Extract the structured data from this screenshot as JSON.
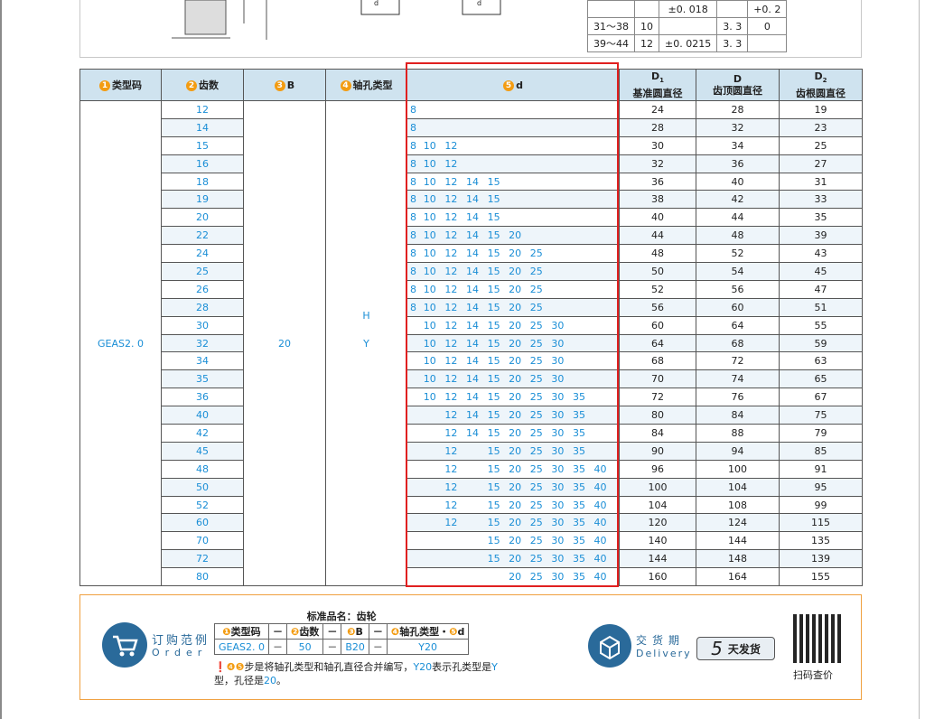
{
  "tolerance_rows": [
    {
      "range": "",
      "val": "",
      "tol": "±0. 018",
      "d": "",
      "extra": "+0. 2"
    },
    {
      "range": "31～38",
      "val": "10",
      "tol": "",
      "d": "3. 3",
      "extra": "0"
    },
    {
      "range": "39～44",
      "val": "12",
      "tol": "±0. 0215",
      "d": "3. 3",
      "extra": ""
    }
  ],
  "drawing_labels": {
    "d1": "d",
    "d2": "d"
  },
  "headers": {
    "type_code": {
      "num": "1",
      "label": "类型码"
    },
    "teeth": {
      "num": "2",
      "label": "齿数"
    },
    "b": {
      "num": "3",
      "label": "B"
    },
    "bore_type": {
      "num": "4",
      "label": "轴孔类型"
    },
    "d": {
      "num": "5",
      "label": "d"
    },
    "d1": {
      "sym": "D",
      "sub": "1",
      "label": "基准圆直径"
    },
    "D": {
      "sym": "D",
      "label": "齿顶圆直径"
    },
    "d2": {
      "sym": "D",
      "sub": "2",
      "label": "齿根圆直径"
    }
  },
  "merged": {
    "type_code": "GEAS2. 0",
    "b": "20",
    "bore_h": "H",
    "bore_y": "Y"
  },
  "rows": [
    {
      "z": "12",
      "d": [
        "8",
        "",
        "",
        "",
        "",
        "",
        "",
        "",
        "",
        ""
      ],
      "d1": "24",
      "D": "28",
      "d2": "19"
    },
    {
      "z": "14",
      "d": [
        "8",
        "",
        "",
        "",
        "",
        "",
        "",
        "",
        "",
        ""
      ],
      "d1": "28",
      "D": "32",
      "d2": "23"
    },
    {
      "z": "15",
      "d": [
        "8",
        "10",
        "12",
        "",
        "",
        "",
        "",
        "",
        "",
        ""
      ],
      "d1": "30",
      "D": "34",
      "d2": "25"
    },
    {
      "z": "16",
      "d": [
        "8",
        "10",
        "12",
        "",
        "",
        "",
        "",
        "",
        "",
        ""
      ],
      "d1": "32",
      "D": "36",
      "d2": "27"
    },
    {
      "z": "18",
      "d": [
        "8",
        "10",
        "12",
        "14",
        "15",
        "",
        "",
        "",
        "",
        ""
      ],
      "d1": "36",
      "D": "40",
      "d2": "31"
    },
    {
      "z": "19",
      "d": [
        "8",
        "10",
        "12",
        "14",
        "15",
        "",
        "",
        "",
        "",
        ""
      ],
      "d1": "38",
      "D": "42",
      "d2": "33"
    },
    {
      "z": "20",
      "d": [
        "8",
        "10",
        "12",
        "14",
        "15",
        "",
        "",
        "",
        "",
        ""
      ],
      "d1": "40",
      "D": "44",
      "d2": "35"
    },
    {
      "z": "22",
      "d": [
        "8",
        "10",
        "12",
        "14",
        "15",
        "20",
        "",
        "",
        "",
        ""
      ],
      "d1": "44",
      "D": "48",
      "d2": "39"
    },
    {
      "z": "24",
      "d": [
        "8",
        "10",
        "12",
        "14",
        "15",
        "20",
        "25",
        "",
        "",
        ""
      ],
      "d1": "48",
      "D": "52",
      "d2": "43"
    },
    {
      "z": "25",
      "d": [
        "8",
        "10",
        "12",
        "14",
        "15",
        "20",
        "25",
        "",
        "",
        ""
      ],
      "d1": "50",
      "D": "54",
      "d2": "45"
    },
    {
      "z": "26",
      "d": [
        "8",
        "10",
        "12",
        "14",
        "15",
        "20",
        "25",
        "",
        "",
        ""
      ],
      "d1": "52",
      "D": "56",
      "d2": "47"
    },
    {
      "z": "28",
      "d": [
        "8",
        "10",
        "12",
        "14",
        "15",
        "20",
        "25",
        "",
        "",
        ""
      ],
      "d1": "56",
      "D": "60",
      "d2": "51"
    },
    {
      "z": "30",
      "d": [
        "",
        "10",
        "12",
        "14",
        "15",
        "20",
        "25",
        "30",
        "",
        ""
      ],
      "d1": "60",
      "D": "64",
      "d2": "55"
    },
    {
      "z": "32",
      "d": [
        "",
        "10",
        "12",
        "14",
        "15",
        "20",
        "25",
        "30",
        "",
        ""
      ],
      "d1": "64",
      "D": "68",
      "d2": "59"
    },
    {
      "z": "34",
      "d": [
        "",
        "10",
        "12",
        "14",
        "15",
        "20",
        "25",
        "30",
        "",
        ""
      ],
      "d1": "68",
      "D": "72",
      "d2": "63"
    },
    {
      "z": "35",
      "d": [
        "",
        "10",
        "12",
        "14",
        "15",
        "20",
        "25",
        "30",
        "",
        ""
      ],
      "d1": "70",
      "D": "74",
      "d2": "65"
    },
    {
      "z": "36",
      "d": [
        "",
        "10",
        "12",
        "14",
        "15",
        "20",
        "25",
        "30",
        "35",
        ""
      ],
      "d1": "72",
      "D": "76",
      "d2": "67"
    },
    {
      "z": "40",
      "d": [
        "",
        "",
        "12",
        "14",
        "15",
        "20",
        "25",
        "30",
        "35",
        ""
      ],
      "d1": "80",
      "D": "84",
      "d2": "75"
    },
    {
      "z": "42",
      "d": [
        "",
        "",
        "12",
        "14",
        "15",
        "20",
        "25",
        "30",
        "35",
        ""
      ],
      "d1": "84",
      "D": "88",
      "d2": "79"
    },
    {
      "z": "45",
      "d": [
        "",
        "",
        "12",
        "",
        "15",
        "20",
        "25",
        "30",
        "35",
        ""
      ],
      "d1": "90",
      "D": "94",
      "d2": "85"
    },
    {
      "z": "48",
      "d": [
        "",
        "",
        "12",
        "",
        "15",
        "20",
        "25",
        "30",
        "35",
        "40"
      ],
      "d1": "96",
      "D": "100",
      "d2": "91"
    },
    {
      "z": "50",
      "d": [
        "",
        "",
        "12",
        "",
        "15",
        "20",
        "25",
        "30",
        "35",
        "40"
      ],
      "d1": "100",
      "D": "104",
      "d2": "95"
    },
    {
      "z": "52",
      "d": [
        "",
        "",
        "12",
        "",
        "15",
        "20",
        "25",
        "30",
        "35",
        "40"
      ],
      "d1": "104",
      "D": "108",
      "d2": "99"
    },
    {
      "z": "60",
      "d": [
        "",
        "",
        "12",
        "",
        "15",
        "20",
        "25",
        "30",
        "35",
        "40"
      ],
      "d1": "120",
      "D": "124",
      "d2": "115"
    },
    {
      "z": "70",
      "d": [
        "",
        "",
        "",
        "",
        "15",
        "20",
        "25",
        "30",
        "35",
        "40"
      ],
      "d1": "140",
      "D": "144",
      "d2": "135"
    },
    {
      "z": "72",
      "d": [
        "",
        "",
        "",
        "",
        "15",
        "20",
        "25",
        "30",
        "35",
        "40"
      ],
      "d1": "144",
      "D": "148",
      "d2": "139"
    },
    {
      "z": "80",
      "d": [
        "",
        "",
        "",
        "",
        "",
        "20",
        "25",
        "30",
        "35",
        "40"
      ],
      "d1": "160",
      "D": "164",
      "d2": "155"
    }
  ],
  "order": {
    "title": "订购范例",
    "subtitle": "Order",
    "std_name": "标准品名：齿轮",
    "h1": "类型码",
    "h2": "齿数",
    "h3": "B",
    "h45": "轴孔类型・",
    "h5": "d",
    "dash": "－",
    "v1": "GEAS2. 0",
    "v2": "50",
    "v3": "B20",
    "v4": "Y20",
    "note_pre": "步是将轴孔类型和轴孔直径合并编写，",
    "note_y20": "Y20",
    "note_mid": "表示孔类型是",
    "note_y": "Y",
    "note_mid2": "型，孔径是",
    "note_20": "20",
    "note_end": "。"
  },
  "delivery": {
    "title": "交货期",
    "subtitle": "Delivery",
    "days": "5",
    "unit": "天发货"
  },
  "qr_label": "扫码查价",
  "colors": {
    "accent_blue": "#1a8ed6",
    "header_bg": "#cfe3ef",
    "highlight_red": "#e02020",
    "badge_orange": "#f39c12"
  }
}
